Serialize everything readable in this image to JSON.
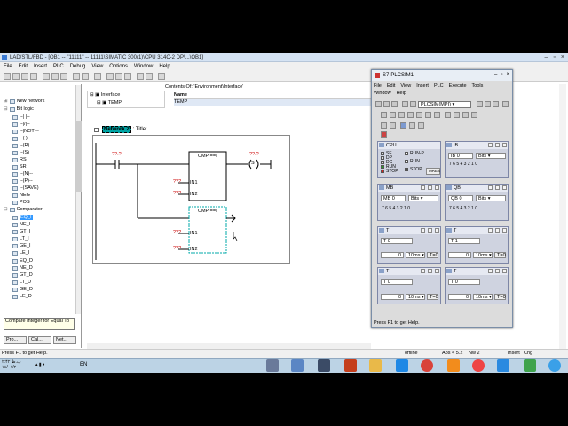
{
  "app": {
    "title": "LAD/STL/FBD - [OB1 -- \"11111\" -- 11111\\SIMATIC 300(1)\\CPU 314C-2 DP\\...\\OB1]",
    "menu": [
      "File",
      "Edit",
      "Insert",
      "PLC",
      "Debug",
      "View",
      "Options",
      "Window",
      "Help"
    ]
  },
  "tree": {
    "items": [
      {
        "prefix": "",
        "label": "New network"
      },
      {
        "prefix": "",
        "label": "Bit logic"
      },
      {
        "prefix": "",
        "label": "--| |--"
      },
      {
        "prefix": "",
        "label": "--|/|--"
      },
      {
        "prefix": "",
        "label": "--|NOT|--"
      },
      {
        "prefix": "",
        "label": "--( )"
      },
      {
        "prefix": "",
        "label": "--(R)"
      },
      {
        "prefix": "",
        "label": "--(S)"
      },
      {
        "prefix": "",
        "label": "RS"
      },
      {
        "prefix": "",
        "label": "SR"
      },
      {
        "prefix": "",
        "label": "--(N)--"
      },
      {
        "prefix": "",
        "label": "--(P)--"
      },
      {
        "prefix": "",
        "label": "--(SAVE)"
      },
      {
        "prefix": "",
        "label": "NEG"
      },
      {
        "prefix": "",
        "label": "POS"
      },
      {
        "prefix": "",
        "label": "Comparator"
      },
      {
        "prefix": "",
        "label": "EQ_I"
      },
      {
        "prefix": "",
        "label": "NE_I"
      },
      {
        "prefix": "",
        "label": "GT_I"
      },
      {
        "prefix": "",
        "label": "LT_I"
      },
      {
        "prefix": "",
        "label": "GE_I"
      },
      {
        "prefix": "",
        "label": "LE_I"
      },
      {
        "prefix": "",
        "label": "EQ_D"
      },
      {
        "prefix": "",
        "label": "NE_D"
      },
      {
        "prefix": "",
        "label": "GT_D"
      },
      {
        "prefix": "",
        "label": "LT_D"
      },
      {
        "prefix": "",
        "label": "GE_D"
      },
      {
        "prefix": "",
        "label": "LE_D"
      }
    ],
    "selected_label": "EQ_I",
    "tooltip": "Compare Integer for Equal To",
    "tabs": [
      "Pro...",
      "Cal...",
      "Net..."
    ]
  },
  "interface": {
    "root": "Interface",
    "child": "TEMP"
  },
  "contents": {
    "header": "Contents Of: 'Environment\\Interface'",
    "column": "Name",
    "row": "TEMP"
  },
  "network": {
    "label": "Network 2",
    "title": ": Title:"
  },
  "ladder": {
    "contact_addr": "??.?",
    "coil_addr": "??.?",
    "coil_symbol": "S",
    "cmp1_title": "CMP ==I",
    "cmp2_title": "CMP ==I",
    "in1": "IN1",
    "in2": "IN2",
    "unknown": "???"
  },
  "status": {
    "help": "Press F1 to get Help.",
    "offline": "offline",
    "abs": "Abs < 5.2",
    "nw": "Nw 2",
    "insert": "Insert",
    "chg": "Chg"
  },
  "plcsim": {
    "title": "S7-PLCSIM1",
    "menu1": [
      "File",
      "Edit",
      "View",
      "Insert",
      "PLC",
      "Execute",
      "Tools"
    ],
    "menu2": [
      "Window",
      "Help"
    ],
    "connection": "PLCSIM(MPI)",
    "cpu": {
      "title": "CPU",
      "leds": [
        "SF",
        "DP",
        "DC",
        "RUN",
        "STOP"
      ],
      "modes": [
        "RUN-P",
        "RUN",
        "STOP"
      ],
      "mres": "MRES"
    },
    "ib": {
      "title": "IB",
      "addr": "IB 0",
      "fmt": "Bits",
      "bits": "7 6 5 4   3 2 1 0"
    },
    "mb": {
      "title": "MB",
      "addr": "MB 0",
      "fmt": "Bits",
      "bits": "7 6 5 4   3 2 1 0"
    },
    "qb": {
      "title": "QB",
      "addr": "QB 0",
      "fmt": "Bits",
      "bits": "7 6 5 4   3 2 1 0"
    },
    "timers": [
      {
        "title": "T",
        "addr": "T  0",
        "val": "0",
        "base": "10ms",
        "btn": "T=0"
      },
      {
        "title": "T",
        "addr": "T  1",
        "val": "0",
        "base": "10ms",
        "btn": "T=0"
      },
      {
        "title": "T",
        "addr": "T  0",
        "val": "0",
        "base": "10ms",
        "btn": "T=0"
      },
      {
        "title": "T",
        "addr": "T  0",
        "val": "0",
        "base": "10ms",
        "btn": "T=0"
      }
    ],
    "status": "Press F1 to get Help."
  },
  "taskbar": {
    "clock_time": "۲:۴۲ ب.ظ",
    "clock_date": "۱۸/۰۱/۲۰",
    "lang": "EN"
  }
}
